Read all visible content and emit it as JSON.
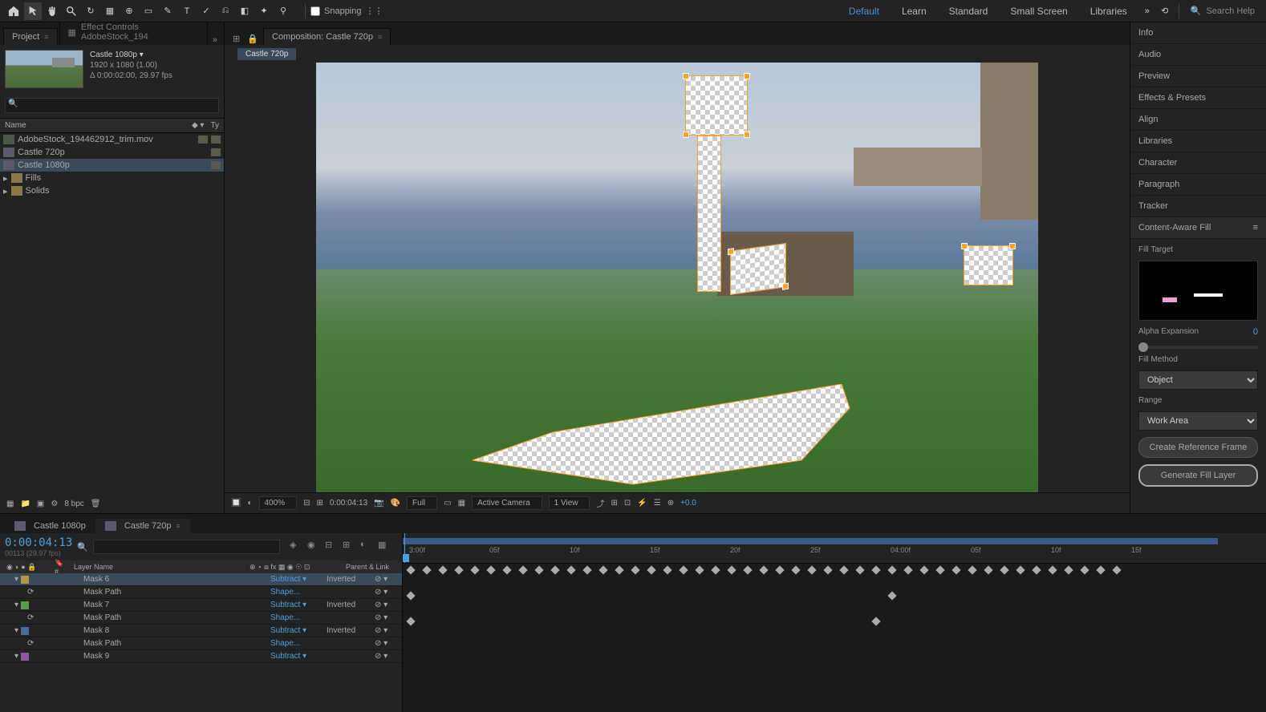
{
  "toolbar": {
    "snapping_label": "Snapping"
  },
  "workspaces": [
    "Default",
    "Learn",
    "Standard",
    "Small Screen",
    "Libraries"
  ],
  "search_placeholder": "Search Help",
  "project": {
    "tab_project": "Project",
    "tab_effects": "Effect Controls AdobeStock_194",
    "comp_name": "Castle 1080p ▾",
    "resolution": "1920 x 1080 (1.00)",
    "duration": "Δ 0:00:02:00, 29.97 fps",
    "name_col": "Name",
    "items": [
      {
        "name": "AdobeStock_194462912_trim.mov",
        "type": "mov"
      },
      {
        "name": "Castle 720p",
        "type": "comp"
      },
      {
        "name": "Castle 1080p",
        "type": "comp",
        "sel": true
      },
      {
        "name": "Fills",
        "type": "folder"
      },
      {
        "name": "Solids",
        "type": "folder"
      }
    ]
  },
  "composition": {
    "tab_label": "Composition: Castle 720p",
    "subtab": "Castle 720p"
  },
  "viewer_controls": {
    "zoom": "400%",
    "timecode": "0:00:04:13",
    "res": "Full",
    "camera": "Active Camera",
    "views": "1 View",
    "exposure": "+0.0"
  },
  "footer": {
    "bpc": "8 bpc"
  },
  "right_panels": [
    "Info",
    "Audio",
    "Preview",
    "Effects & Presets",
    "Align",
    "Libraries",
    "Character",
    "Paragraph",
    "Tracker"
  ],
  "caf": {
    "title": "Content-Aware Fill",
    "fill_target": "Fill Target",
    "alpha_expansion": "Alpha Expansion",
    "alpha_value": "0",
    "fill_method": "Fill Method",
    "method_value": "Object",
    "range": "Range",
    "range_value": "Work Area",
    "btn_ref": "Create Reference Frame",
    "btn_gen": "Generate Fill Layer"
  },
  "timeline": {
    "tabs": [
      {
        "label": "Castle 1080p"
      },
      {
        "label": "Castle 720p",
        "active": true
      }
    ],
    "timecode": "0:00:04:13",
    "subtime": "00113 (29.97 fps)",
    "col_layer_name": "Layer Name",
    "col_parent": "Parent & Link",
    "ticks": [
      "3:00f",
      "05f",
      "10f",
      "15f",
      "20f",
      "25f",
      "04:00f",
      "05f",
      "10f",
      "15f"
    ],
    "layers": [
      {
        "name": "Mask 6",
        "mode": "Subtract ▾",
        "inv": "Inverted",
        "color": "lc-yellow",
        "sel": true
      },
      {
        "name": "Mask Path",
        "mode": "Shape...",
        "sub": true
      },
      {
        "name": "Mask 7",
        "mode": "Subtract ▾",
        "inv": "Inverted",
        "color": "lc-green"
      },
      {
        "name": "Mask Path",
        "mode": "Shape...",
        "sub": true
      },
      {
        "name": "Mask 8",
        "mode": "Subtract ▾",
        "inv": "Inverted",
        "color": "lc-blue"
      },
      {
        "name": "Mask Path",
        "mode": "Shape...",
        "sub": true
      },
      {
        "name": "Mask 9",
        "mode": "Subtract ▾",
        "color": "lc-purple"
      }
    ]
  }
}
